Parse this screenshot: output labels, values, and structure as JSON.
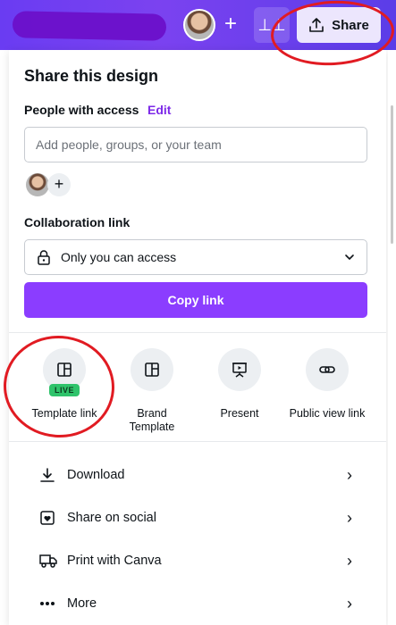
{
  "topbar": {
    "share_label": "Share"
  },
  "panel": {
    "title": "Share this design",
    "people_label": "People with access",
    "edit_label": "Edit",
    "add_placeholder": "Add people, groups, or your team",
    "collab_label": "Collaboration link",
    "access_value": "Only you can access",
    "copy_label": "Copy link"
  },
  "options": [
    {
      "label": "Template link",
      "badge": "LIVE",
      "icon": "template-icon"
    },
    {
      "label": "Brand Template",
      "icon": "brand-template-icon"
    },
    {
      "label": "Present",
      "icon": "present-icon"
    },
    {
      "label": "Public view link",
      "icon": "link-icon"
    }
  ],
  "actions": [
    {
      "label": "Download",
      "icon": "download-icon"
    },
    {
      "label": "Share on social",
      "icon": "heart-icon"
    },
    {
      "label": "Print with Canva",
      "icon": "truck-icon"
    },
    {
      "label": "More",
      "icon": "more-icon"
    }
  ],
  "colors": {
    "accent": "#8b3dff",
    "topbar": "#6a3cf2",
    "annotation": "#e11b22",
    "live": "#2fc36b"
  }
}
